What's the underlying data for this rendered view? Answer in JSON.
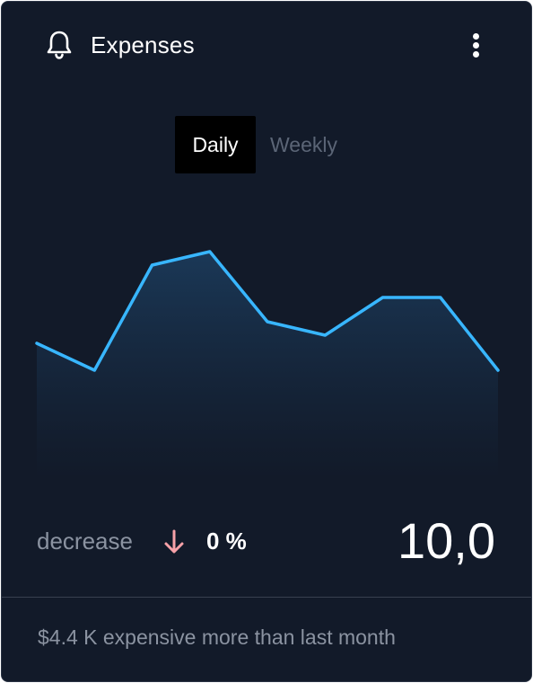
{
  "header": {
    "title": "Expenses",
    "icon": "bell-icon",
    "menu_icon": "kebab-menu-icon"
  },
  "tabs": [
    {
      "label": "Daily",
      "active": true
    },
    {
      "label": "Weekly",
      "active": false
    }
  ],
  "stats": {
    "change_label": "decrease",
    "change_icon": "arrow-down-icon",
    "change_value": "0 %",
    "total_value": "10,0"
  },
  "footer": {
    "text": "$4.4 K expensive more than last month"
  },
  "colors": {
    "background": "#121a29",
    "line": "#38b6ff",
    "arrow": "#f7a1a8",
    "muted_text": "#8b93a1"
  },
  "chart_data": {
    "type": "area",
    "values": [
      50,
      40,
      79,
      84,
      58,
      53,
      67,
      67,
      40
    ],
    "ylim": [
      0,
      100
    ],
    "grid": false,
    "legend": "none",
    "xlabel": "",
    "ylabel": ""
  }
}
